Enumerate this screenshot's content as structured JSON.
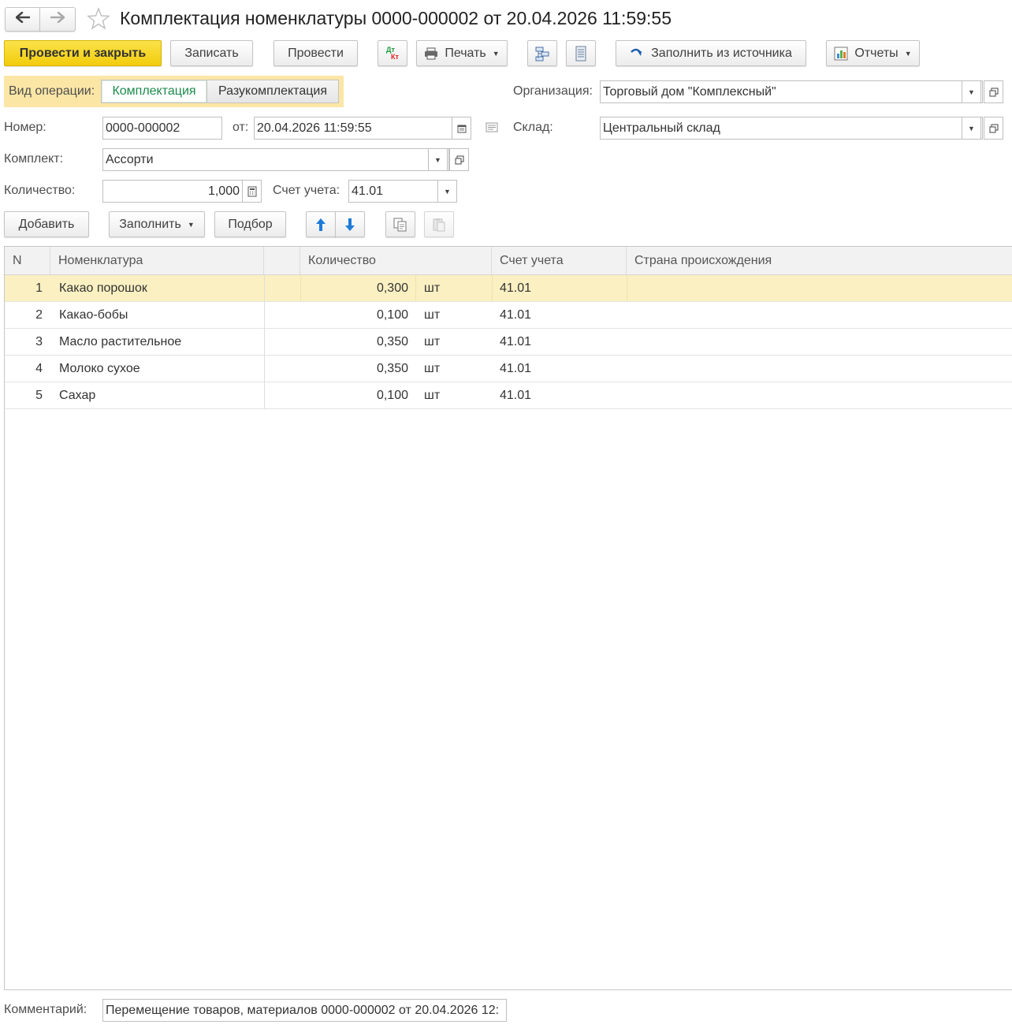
{
  "window": {
    "title": "Комплектация номенклатуры 0000-000002 от 20.04.2026 11:59:55"
  },
  "toolbar": {
    "post_close": "Провести и закрыть",
    "save": "Записать",
    "post": "Провести",
    "dtkt_top": "Дт",
    "dtkt_bottom": "Кт",
    "print": "Печать",
    "fill_from_source": "Заполнить из источника",
    "reports": "Отчеты"
  },
  "form": {
    "operation_label": "Вид операции:",
    "operation_options": [
      "Комплектация",
      "Разукомплектация"
    ],
    "operation_selected": "Комплектация",
    "org_label": "Организация:",
    "org_value": "Торговый дом \"Комплексный\"",
    "number_label": "Номер:",
    "number_value": "0000-000002",
    "date_label": "от:",
    "date_value": "20.04.2026 11:59:55",
    "warehouse_label": "Склад:",
    "warehouse_value": "Центральный склад",
    "kit_label": "Комплект:",
    "kit_value": "Ассорти",
    "qty_label": "Количество:",
    "qty_value": "1,000",
    "account_label": "Счет учета:",
    "account_value": "41.01"
  },
  "table_toolbar": {
    "add": "Добавить",
    "fill": "Заполнить",
    "pick": "Подбор"
  },
  "table": {
    "columns": [
      "N",
      "Номенклатура",
      "Количество",
      "Счет учета",
      "Страна происхождения"
    ],
    "rows": [
      {
        "n": "1",
        "item": "Какао порошок",
        "qty": "0,300",
        "unit": "шт",
        "account": "41.01",
        "country": ""
      },
      {
        "n": "2",
        "item": "Какао-бобы",
        "qty": "0,100",
        "unit": "шт",
        "account": "41.01",
        "country": ""
      },
      {
        "n": "3",
        "item": "Масло растительное",
        "qty": "0,350",
        "unit": "шт",
        "account": "41.01",
        "country": ""
      },
      {
        "n": "4",
        "item": "Молоко сухое",
        "qty": "0,350",
        "unit": "шт",
        "account": "41.01",
        "country": ""
      },
      {
        "n": "5",
        "item": "Сахар",
        "qty": "0,100",
        "unit": "шт",
        "account": "41.01",
        "country": ""
      }
    ],
    "selected_row": 1
  },
  "comment": {
    "label": "Комментарий:",
    "value": "Перемещение товаров, материалов 0000-000002 от 20.04.2026 12:"
  },
  "colors": {
    "primary_button": "#f2cc0c",
    "selected_row": "#fbf0c2",
    "radio_selected_text": "#1a8a4a",
    "arrow_blue": "#1e7bd8"
  }
}
